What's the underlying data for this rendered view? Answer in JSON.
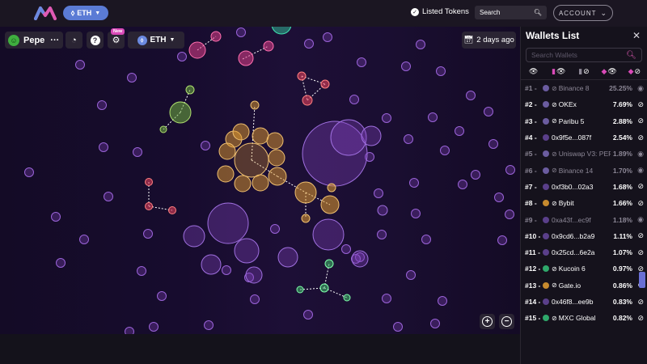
{
  "topbar": {
    "chain_label": "ETH",
    "listed_tokens_label": "Listed Tokens",
    "search_placeholder": "Search",
    "account_label": "ACCOUNT"
  },
  "map_controls": {
    "token_name": "Pepe",
    "token_more": "···",
    "new_badge": "New",
    "network_label": "ETH",
    "time_range": "2 days ago"
  },
  "sidebar": {
    "title": "Wallets List",
    "search_placeholder": "Search Wallets",
    "wallets": [
      {
        "rank": "#1 -",
        "name": "Binance 8",
        "pct": "25.25%",
        "dot": "#6b5ca0",
        "hidden": true,
        "exchange": true
      },
      {
        "rank": "#2 -",
        "name": "OKEx",
        "pct": "7.69%",
        "dot": "#6b5ca0",
        "hidden": false,
        "exchange": true
      },
      {
        "rank": "#3 -",
        "name": "Paribu 5",
        "pct": "2.88%",
        "dot": "#6b5ca0",
        "hidden": false,
        "exchange": true
      },
      {
        "rank": "#4 -",
        "name": "0x9f5e...087f",
        "pct": "2.54%",
        "dot": "#5a3f8a",
        "hidden": false,
        "exchange": false
      },
      {
        "rank": "#5 -",
        "name": "Uniswap V3: PEP...",
        "pct": "1.89%",
        "dot": "#6b5ca0",
        "hidden": true,
        "exchange": true
      },
      {
        "rank": "#6 -",
        "name": "Binance 14",
        "pct": "1.70%",
        "dot": "#6b5ca0",
        "hidden": true,
        "exchange": true
      },
      {
        "rank": "#7 -",
        "name": "0xf3b0...02a3",
        "pct": "1.68%",
        "dot": "#5a3f8a",
        "hidden": false,
        "exchange": false
      },
      {
        "rank": "#8 -",
        "name": "Bybit",
        "pct": "1.66%",
        "dot": "#c68a2e",
        "hidden": false,
        "exchange": true
      },
      {
        "rank": "#9 -",
        "name": "0xa43f...ec9f",
        "pct": "1.18%",
        "dot": "#5a3f8a",
        "hidden": true,
        "exchange": false
      },
      {
        "rank": "#10 -",
        "name": "0x9cd6...b2a9",
        "pct": "1.11%",
        "dot": "#5a3f8a",
        "hidden": false,
        "exchange": false
      },
      {
        "rank": "#11 -",
        "name": "0x25cd...6e2a",
        "pct": "1.07%",
        "dot": "#5a3f8a",
        "hidden": false,
        "exchange": false
      },
      {
        "rank": "#12 -",
        "name": "Kucoin 6",
        "pct": "0.97%",
        "dot": "#2fa86b",
        "hidden": false,
        "exchange": true
      },
      {
        "rank": "#13 -",
        "name": "Gate.io",
        "pct": "0.86%",
        "dot": "#c68a2e",
        "hidden": false,
        "exchange": true
      },
      {
        "rank": "#14 -",
        "name": "0x46f8...ee9b",
        "pct": "0.83%",
        "dot": "#5a3f8a",
        "hidden": false,
        "exchange": false
      },
      {
        "rank": "#15 -",
        "name": "MXC Global",
        "pct": "0.82%",
        "dot": "#2fa86b",
        "hidden": false,
        "exchange": true
      }
    ]
  },
  "colors": {
    "accent_pink": "#d94ab8",
    "chain_blue": "#5b7bd5",
    "bubble_purple": "#7b3fb5",
    "cluster_orange": "#e09a2e",
    "cluster_green": "#3fc06b",
    "cluster_red": "#e0405a"
  }
}
